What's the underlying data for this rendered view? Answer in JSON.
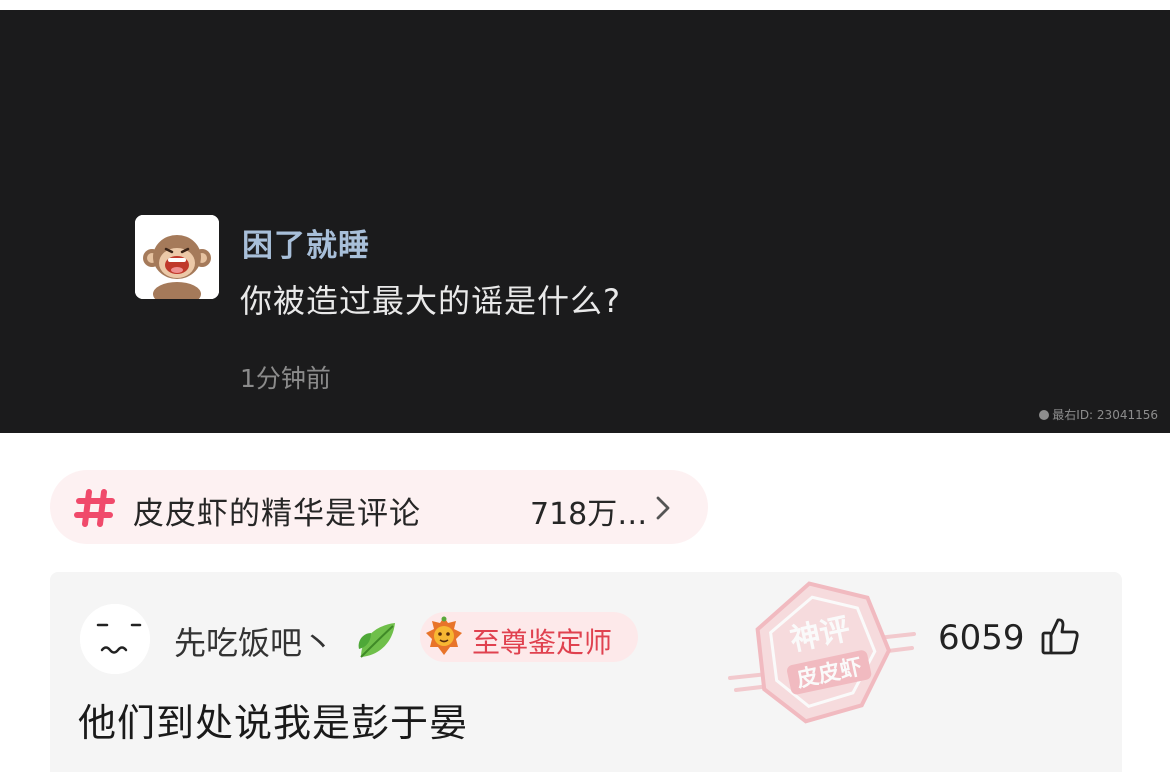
{
  "post": {
    "author": "困了就睡",
    "question": "你被造过最大的谣是什么?",
    "time": "1分钟前",
    "watermark": "最右ID: 23041156",
    "avatar_icon": "monkey-avatar-icon"
  },
  "topic": {
    "title": "皮皮虾的精华是评论",
    "count": "718万…",
    "hash_color": "#f04a6b",
    "icons": [
      "hash-icon",
      "chevron-right-icon"
    ]
  },
  "comment": {
    "username": "先吃饭吧丶",
    "badge": "至尊鉴定师",
    "badge_color": "#e0414f",
    "stamp_top": "神评",
    "stamp_bottom": "皮皮虾",
    "likes": "6059",
    "text": "他们到处说我是彭于晏",
    "icons": [
      "sad-face-avatar-icon",
      "leaf-icon",
      "lion-badge-icon",
      "thumbs-up-icon"
    ]
  }
}
